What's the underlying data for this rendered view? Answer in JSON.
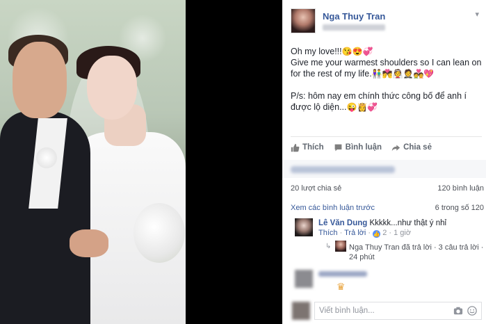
{
  "post": {
    "author": "Nga Thuy Tran",
    "body": {
      "line1": "Oh my love!!!",
      "line1_emojis": "😘😍💞",
      "line2": "Give me your warmest shoulders so I can lean on for the rest of my life.",
      "line2_emojis": "👫💏👰🤵💑💖",
      "line3": "P/s: hôm nay em chính thức công bố để anh í được lộ diện...",
      "line3_emojis": "😜👸💞"
    },
    "actions": {
      "like": "Thích",
      "comment": "Bình luận",
      "share": "Chia sẻ"
    },
    "stats": {
      "shares": "20 lượt chia sẻ",
      "comments": "120 bình luận"
    },
    "previous": {
      "label": "Xem các bình luận trước",
      "count": "6 trong số 120"
    },
    "comment": {
      "name": "Lê Văn Dung",
      "text": "Kkkkk...như thật ý nhỉ",
      "like": "Thích",
      "reply": "Trả lời",
      "like_count": "2",
      "time": "1 giờ"
    },
    "reply_summary": {
      "text": "Nga Thuy Tran đã trả lời · 3 câu trả lời · 24 phút"
    },
    "composer": {
      "placeholder": "Viết bình luận..."
    }
  },
  "colors": {
    "link": "#365899",
    "meta": "#90949c",
    "like_badge": "#5890ff"
  }
}
